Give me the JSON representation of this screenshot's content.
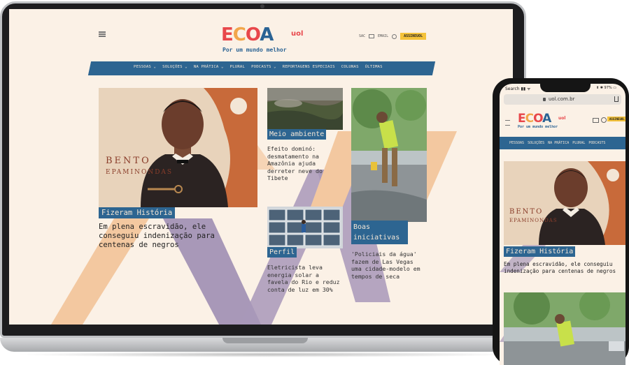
{
  "site": {
    "logo_letters": [
      "E",
      "C",
      "O",
      "A"
    ],
    "logo_suffix": "uol",
    "tagline": "Por um mundo melhor",
    "header_links": {
      "sac": "SAC",
      "email": "EMAIL",
      "subscribe": "ASSINEUOL"
    },
    "nav": [
      "PESSOAS ⌄",
      "SOLUÇÕES ⌄",
      "NA PRÁTICA ⌄",
      "PLURAL",
      "PODCASTS ⌄",
      "REPORTAGENS ESPECIAIS",
      "COLUNAS",
      "ÚLTIMAS"
    ],
    "colors": {
      "beige": "#fbf1e6",
      "blue": "#2d6591",
      "red": "#e8474b",
      "orange": "#f2a64a",
      "lilac": "#a898b8",
      "peach": "#f3c8a0"
    }
  },
  "hero": {
    "portrait_lines": [
      "BENTO",
      "EPAMINONDAS"
    ],
    "section": "Fizeram História",
    "headline": "Em plena escravidão, ele conseguiu indenização para centenas de negros"
  },
  "cards": [
    {
      "section": "Meio ambiente",
      "headline": "Efeito dominó: desmatamento na Amazônia ajuda derreter neve do Tibete"
    },
    {
      "section": "Boas iniciativas",
      "headline": "'Policiais da água' fazem de Las Vegas uma cidade-modelo em tempos de seca"
    },
    {
      "section": "Perfil",
      "headline": "Eletricista leva energia solar a favela do Rio e reduz conta de luz em 30%"
    }
  ],
  "phone": {
    "status_left": "Search ▮▮ ᯤ",
    "status_right": "⬆ ✱ 97% ▭",
    "url": "uol.com.br",
    "nav": [
      "PESSOAS",
      "SOLUÇÕES",
      "NA PRÁTICA",
      "PLURAL",
      "PODCASTS"
    ],
    "hero_section": "Fizeram História",
    "hero_headline": "Em plena escravidão, ele conseguiu indenização para centenas de negros"
  }
}
